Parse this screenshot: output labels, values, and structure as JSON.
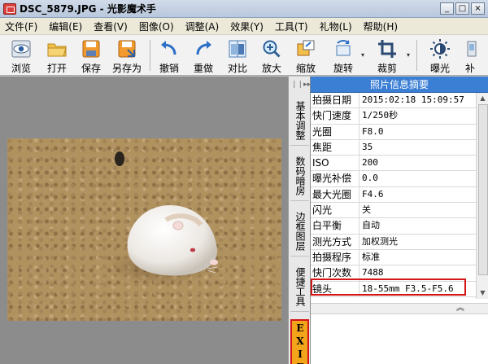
{
  "window": {
    "title": "DSC_5879.JPG - 光影魔术手",
    "buttons": [
      "_",
      "□",
      "×"
    ]
  },
  "menu": [
    "文件(F)",
    "编辑(E)",
    "查看(V)",
    "图像(O)",
    "调整(A)",
    "效果(Y)",
    "工具(T)",
    "礼物(L)",
    "帮助(H)"
  ],
  "toolbar": {
    "browse": "浏览",
    "open": "打开",
    "save": "保存",
    "save_as": "另存为",
    "undo": "撤销",
    "redo": "重做",
    "compare": "对比",
    "zoom_in": "放大",
    "zoom_out": "缩放",
    "rotate": "旋转",
    "crop": "裁剪",
    "exposure": "曝光",
    "more": "补"
  },
  "side_tabs": {
    "strip_top": "❘❘▸▸",
    "basic": "基本调整",
    "digital": "数码暗房",
    "border": "边框图层",
    "tools": "便捷工具",
    "exif": "EXIF"
  },
  "panel": {
    "title": "照片信息摘要",
    "rows": [
      {
        "k": "拍摄日期",
        "v": "2015:02:18 15:09:57"
      },
      {
        "k": "快门速度",
        "v": "1/250秒"
      },
      {
        "k": "光圈",
        "v": "F8.0"
      },
      {
        "k": "焦距",
        "v": "35"
      },
      {
        "k": "ISO",
        "v": "200"
      },
      {
        "k": "曝光补偿",
        "v": "0.0"
      },
      {
        "k": "最大光圈",
        "v": "F4.6"
      },
      {
        "k": "闪光",
        "v": "关"
      },
      {
        "k": "白平衡",
        "v": "自动"
      },
      {
        "k": "测光方式",
        "v": "加权测光"
      },
      {
        "k": "拍摄程序",
        "v": "标准"
      },
      {
        "k": "快门次数",
        "v": "7488"
      },
      {
        "k": "镜头",
        "v": "18-55mm F3.5-F5.6"
      }
    ],
    "collapse": "︽"
  },
  "colors": {
    "accent": "#3b7fd5",
    "highlight": "#d31515",
    "active_tab": "#f2a41a"
  }
}
